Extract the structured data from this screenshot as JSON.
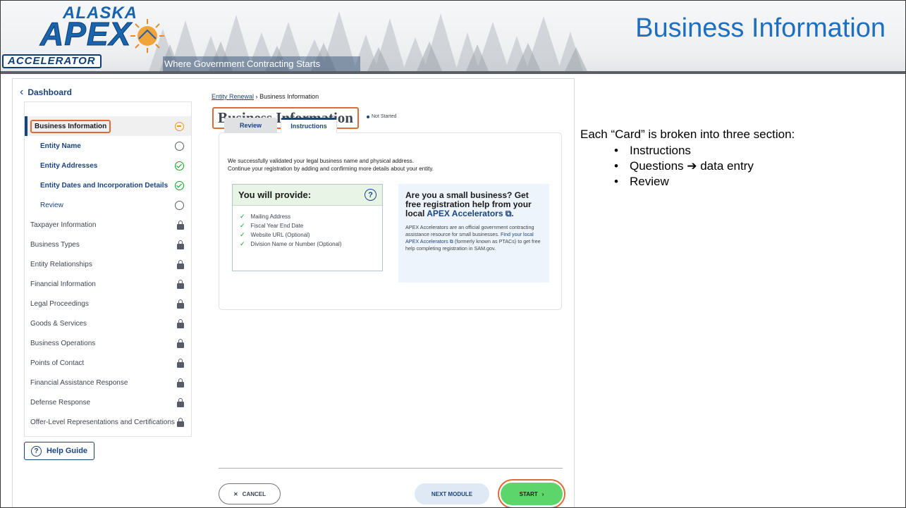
{
  "header": {
    "logo_top": "ALASKA",
    "logo_main": "APEX",
    "logo_bottom": "ACCELERATOR",
    "tagline": "Where Government Contracting Starts",
    "slide_title": "Business Information"
  },
  "app": {
    "dashboard_link": "Dashboard",
    "sidebar": [
      {
        "label": "Business Information",
        "status": "in-progress-icon",
        "kind": "active"
      },
      {
        "label": "Entity Name",
        "status": "empty-circle-icon",
        "kind": "sub"
      },
      {
        "label": "Entity Addresses",
        "status": "check-circle-icon",
        "kind": "sub"
      },
      {
        "label": "Entity Dates and Incorporation Details",
        "status": "check-circle-icon",
        "kind": "sub"
      },
      {
        "label": "Review",
        "status": "empty-circle-icon",
        "kind": "review"
      },
      {
        "label": "Taxpayer Information",
        "status": "lock-icon",
        "kind": "locked"
      },
      {
        "label": "Business Types",
        "status": "lock-icon",
        "kind": "locked"
      },
      {
        "label": "Entity Relationships",
        "status": "lock-icon",
        "kind": "locked"
      },
      {
        "label": "Financial Information",
        "status": "lock-icon",
        "kind": "locked"
      },
      {
        "label": "Legal Proceedings",
        "status": "lock-icon",
        "kind": "locked"
      },
      {
        "label": "Goods & Services",
        "status": "lock-icon",
        "kind": "locked"
      },
      {
        "label": "Business Operations",
        "status": "lock-icon",
        "kind": "locked"
      },
      {
        "label": "Points of Contact",
        "status": "lock-icon",
        "kind": "locked"
      },
      {
        "label": "Financial Assistance Response",
        "status": "lock-icon",
        "kind": "locked"
      },
      {
        "label": "Defense Response",
        "status": "lock-icon",
        "kind": "locked"
      },
      {
        "label": "Offer-Level Representations and Certifications",
        "status": "lock-icon",
        "kind": "locked"
      }
    ],
    "help_guide": "Help Guide",
    "breadcrumb": {
      "link": "Entity Renewal",
      "separator": "›",
      "current": "Business Information"
    },
    "page_title": "Business Information",
    "status_badge": "Not Started",
    "tabs": {
      "review": "Review",
      "instructions": "Instructions"
    },
    "intro_line1": "We successfully validated your legal business name and physical address.",
    "intro_line2": "Continue your registration by adding and confirming more details about your entity.",
    "provide": {
      "title": "You will provide:",
      "items": [
        "Mailing Address",
        "Fiscal Year End Date",
        "Website URL (Optional)",
        "Division Name or Number (Optional)"
      ]
    },
    "apex": {
      "head_text": "Are you a small business? Get free registration help from your local ",
      "head_link": "APEX Accelerators",
      "body_1": "APEX Accelerators are an official government contracting assistance resource for small businesses. ",
      "body_link": "Find your local APEX Accelerators",
      "body_2": " (formerly known as PTACs) to get free help completing registration in SAM.gov."
    },
    "buttons": {
      "cancel": "CANCEL",
      "next_module": "NEXT MODULE",
      "start": "START"
    }
  },
  "notes": {
    "intro": "Each “Card” is broken into three section:",
    "bullets": [
      "Instructions",
      "Questions ➔ data entry",
      "Review"
    ]
  },
  "colors": {
    "accent": "#1a4480",
    "title_blue": "#1f6fc0",
    "highlight": "#e06a3a",
    "start_green": "#5cd66a",
    "check_green": "#00a91c"
  }
}
